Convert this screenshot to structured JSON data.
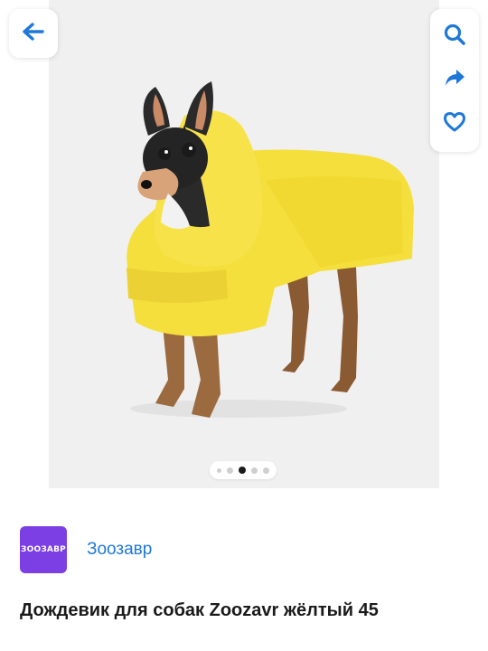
{
  "gallery": {
    "image_alt": "",
    "dots": {
      "count": 5,
      "active_index": 2
    }
  },
  "icons": {
    "back": "arrow-left-icon",
    "search": "search-icon",
    "share": "share-arrow-icon",
    "favorite": "heart-icon"
  },
  "seller": {
    "logo_text": "ЗООЗАВР",
    "name": "Зоозавр"
  },
  "product": {
    "title": "Дождевик для собак Zoozavr жёлтый 45"
  },
  "colors": {
    "accent": "#1e78d7",
    "seller_logo_bg": "#7b3fe4",
    "raincoat": "#f5df3c"
  }
}
